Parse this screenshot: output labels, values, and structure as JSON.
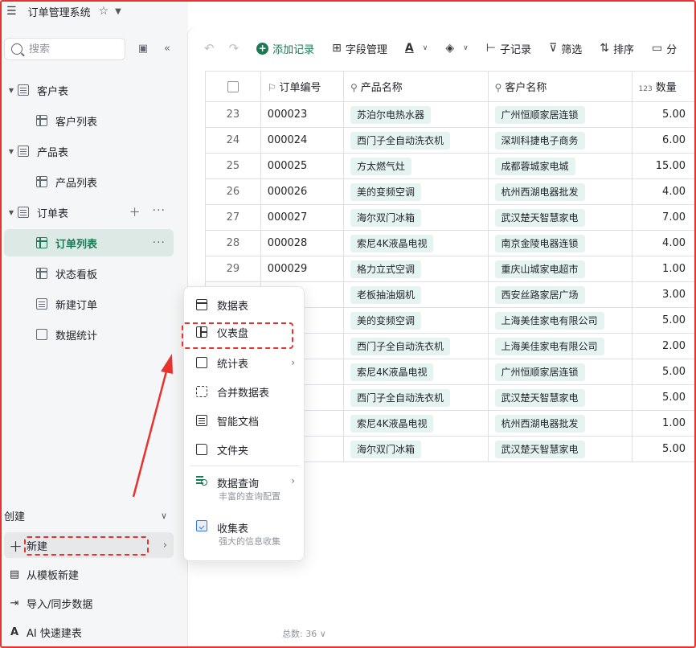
{
  "app": {
    "title": "订单管理系统",
    "accent": "#1a7a54",
    "annotation_color": "#e8322e"
  },
  "sidebar": {
    "search_placeholder": "搜索",
    "tree": [
      {
        "label": "客户表",
        "level": 0,
        "icon": "list-icon"
      },
      {
        "label": "客户列表",
        "level": 1,
        "icon": "table-icon"
      },
      {
        "label": "产品表",
        "level": 0,
        "icon": "list-icon"
      },
      {
        "label": "产品列表",
        "level": 1,
        "icon": "table-icon"
      },
      {
        "label": "订单表",
        "level": 0,
        "icon": "list-icon"
      },
      {
        "label": "订单列表",
        "level": 1,
        "icon": "table-icon",
        "active": true
      },
      {
        "label": "状态看板",
        "level": 1,
        "icon": "kanban-icon"
      },
      {
        "label": "新建订单",
        "level": 1,
        "icon": "form-icon"
      },
      {
        "label": "数据统计",
        "level": 1,
        "icon": "image-icon"
      }
    ],
    "create_label": "创建",
    "bottom": [
      {
        "label": "新建",
        "icon": "plus-icon"
      },
      {
        "label": "从模板新建",
        "icon": "template-icon"
      },
      {
        "label": "导入/同步数据",
        "icon": "import-icon"
      },
      {
        "label": "AI 快速建表",
        "icon": "ai-icon"
      }
    ]
  },
  "toolbar": {
    "add_record": "添加记录",
    "field_manage": "字段管理",
    "sub_record": "子记录",
    "filter": "筛选",
    "sort": "排序",
    "group": "分"
  },
  "table": {
    "headers": [
      "订单编号",
      "产品名称",
      "客户名称",
      "数量"
    ],
    "rows": [
      {
        "n": "23",
        "id": "000023",
        "product": "苏泊尔电热水器",
        "customer": "广州恒顺家居连锁",
        "qty": "5.00"
      },
      {
        "n": "24",
        "id": "000024",
        "product": "西门子全自动洗衣机",
        "customer": "深圳科捷电子商务",
        "qty": "6.00"
      },
      {
        "n": "25",
        "id": "000025",
        "product": "方太燃气灶",
        "customer": "成都蓉城家电城",
        "qty": "15.00"
      },
      {
        "n": "26",
        "id": "000026",
        "product": "美的变频空调",
        "customer": "杭州西湖电器批发",
        "qty": "4.00"
      },
      {
        "n": "27",
        "id": "000027",
        "product": "海尔双门冰箱",
        "customer": "武汉楚天智慧家电",
        "qty": "7.00"
      },
      {
        "n": "28",
        "id": "000028",
        "product": "索尼4K液晶电视",
        "customer": "南京金陵电器连锁",
        "qty": "4.00"
      },
      {
        "n": "29",
        "id": "000029",
        "product": "格力立式空调",
        "customer": "重庆山城家电超市",
        "qty": "1.00"
      },
      {
        "n": "",
        "id": "",
        "product": "老板抽油烟机",
        "customer": "西安丝路家居广场",
        "qty": "3.00"
      },
      {
        "n": "",
        "id": "",
        "product": "美的变频空调",
        "customer": "上海美佳家电有限公司",
        "qty": "5.00"
      },
      {
        "n": "",
        "id": "",
        "product": "西门子全自动洗衣机",
        "customer": "上海美佳家电有限公司",
        "qty": "2.00"
      },
      {
        "n": "",
        "id": "",
        "product": "索尼4K液晶电视",
        "customer": "广州恒顺家居连锁",
        "qty": "5.00"
      },
      {
        "n": "",
        "id": "",
        "product": "西门子全自动洗衣机",
        "customer": "武汉楚天智慧家电",
        "qty": "5.00"
      },
      {
        "n": "",
        "id": "",
        "product": "索尼4K液晶电视",
        "customer": "杭州西湖电器批发",
        "qty": "1.00"
      },
      {
        "n": "",
        "id": "",
        "product": "海尔双门冰箱",
        "customer": "武汉楚天智慧家电",
        "qty": "5.00"
      }
    ],
    "total_label": "总数: 36"
  },
  "menu": {
    "items": [
      {
        "label": "数据表",
        "icon": "table-icon"
      },
      {
        "label": "仪表盘",
        "icon": "dashboard-icon"
      },
      {
        "label": "统计表",
        "icon": "stats-icon",
        "arrow": true
      },
      {
        "label": "合并数据表",
        "icon": "merge-icon"
      },
      {
        "label": "智能文档",
        "icon": "doc-icon"
      },
      {
        "label": "文件夹",
        "icon": "folder-icon"
      },
      {
        "label": "数据查询",
        "icon": "query-icon",
        "arrow": true,
        "sub": "丰富的查询配置"
      },
      {
        "label": "收集表",
        "icon": "form-icon",
        "sub": "强大的信息收集"
      }
    ]
  }
}
